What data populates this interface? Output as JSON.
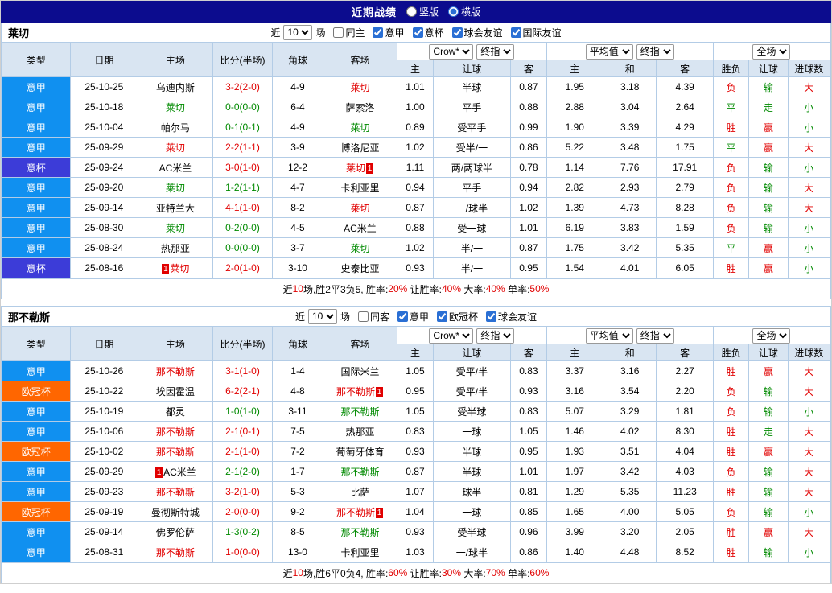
{
  "topbar": {
    "title": "近期战绩",
    "vertical": {
      "label": "竖版",
      "selected": false
    },
    "horizontal": {
      "label": "横版",
      "selected": true
    }
  },
  "colors": {
    "red": "#e10000",
    "green": "#008a00",
    "black": "#000000"
  },
  "league_colors": {
    "意甲": "#1090f0",
    "意杯": "#3c3cd8",
    "欧冠杯": "#ff6600"
  },
  "table": {
    "main_headers": [
      "类型",
      "日期",
      "主场",
      "比分(半场)",
      "角球",
      "客场"
    ],
    "sub_headers": [
      "主",
      "让球",
      "客",
      "主",
      "和",
      "客",
      "胜负",
      "让球",
      "进球数"
    ],
    "selects": {
      "odds_source": "Crow*",
      "odds_kind": "终指",
      "euro_source": "平均值",
      "euro_kind": "终指",
      "scope": "全场"
    }
  },
  "sections": [
    {
      "team": "莱切",
      "filter": {
        "near": "近",
        "count": "10",
        "unit": "场",
        "checkboxes": [
          {
            "label": "同主",
            "checked": false
          },
          {
            "label": "意甲",
            "checked": true
          },
          {
            "label": "意杯",
            "checked": true
          },
          {
            "label": "球会友谊",
            "checked": true
          },
          {
            "label": "国际友谊",
            "checked": true
          }
        ]
      },
      "rows": [
        {
          "type": "意甲",
          "date": "25-10-25",
          "home": "乌迪内斯",
          "home_color": "black",
          "score": "3-2(2-0)",
          "score_color": "red",
          "corners": "4-9",
          "away": "莱切",
          "away_color": "red",
          "ah_h": "1.01",
          "ah_l": "半球",
          "ah_a": "0.87",
          "eu_h": "1.95",
          "eu_d": "3.18",
          "eu_a": "4.39",
          "res": "负",
          "res_c": "red",
          "cov": "输",
          "cov_c": "green",
          "ou": "大",
          "ou_c": "red"
        },
        {
          "type": "意甲",
          "date": "25-10-18",
          "home": "莱切",
          "home_color": "green",
          "score": "0-0(0-0)",
          "score_color": "green",
          "corners": "6-4",
          "away": "萨索洛",
          "away_color": "black",
          "ah_h": "1.00",
          "ah_l": "平手",
          "ah_a": "0.88",
          "eu_h": "2.88",
          "eu_d": "3.04",
          "eu_a": "2.64",
          "res": "平",
          "res_c": "green",
          "cov": "走",
          "cov_c": "green",
          "ou": "小",
          "ou_c": "green"
        },
        {
          "type": "意甲",
          "date": "25-10-04",
          "home": "帕尔马",
          "home_color": "black",
          "score": "0-1(0-1)",
          "score_color": "green",
          "corners": "4-9",
          "away": "莱切",
          "away_color": "green",
          "ah_h": "0.89",
          "ah_l": "受平手",
          "ah_a": "0.99",
          "eu_h": "1.90",
          "eu_d": "3.39",
          "eu_a": "4.29",
          "res": "胜",
          "res_c": "red",
          "cov": "赢",
          "cov_c": "red",
          "ou": "小",
          "ou_c": "green"
        },
        {
          "type": "意甲",
          "date": "25-09-29",
          "home": "莱切",
          "home_color": "red",
          "score": "2-2(1-1)",
          "score_color": "red",
          "corners": "3-9",
          "away": "博洛尼亚",
          "away_color": "black",
          "ah_h": "1.02",
          "ah_l": "受半/一",
          "ah_a": "0.86",
          "eu_h": "5.22",
          "eu_d": "3.48",
          "eu_a": "1.75",
          "res": "平",
          "res_c": "green",
          "cov": "赢",
          "cov_c": "red",
          "ou": "大",
          "ou_c": "red"
        },
        {
          "type": "意杯",
          "date": "25-09-24",
          "home": "AC米兰",
          "home_color": "black",
          "score": "3-0(1-0)",
          "score_color": "red",
          "corners": "12-2",
          "away": "莱切",
          "away_color": "red",
          "away_badge": "1",
          "away_badge_pos": "after",
          "ah_h": "1.11",
          "ah_l": "两/两球半",
          "ah_a": "0.78",
          "eu_h": "1.14",
          "eu_d": "7.76",
          "eu_a": "17.91",
          "res": "负",
          "res_c": "red",
          "cov": "输",
          "cov_c": "green",
          "ou": "小",
          "ou_c": "green"
        },
        {
          "type": "意甲",
          "date": "25-09-20",
          "home": "莱切",
          "home_color": "green",
          "score": "1-2(1-1)",
          "score_color": "green",
          "corners": "4-7",
          "away": "卡利亚里",
          "away_color": "black",
          "ah_h": "0.94",
          "ah_l": "平手",
          "ah_a": "0.94",
          "eu_h": "2.82",
          "eu_d": "2.93",
          "eu_a": "2.79",
          "res": "负",
          "res_c": "red",
          "cov": "输",
          "cov_c": "green",
          "ou": "大",
          "ou_c": "red"
        },
        {
          "type": "意甲",
          "date": "25-09-14",
          "home": "亚特兰大",
          "home_color": "black",
          "score": "4-1(1-0)",
          "score_color": "red",
          "corners": "8-2",
          "away": "莱切",
          "away_color": "red",
          "ah_h": "0.87",
          "ah_l": "一/球半",
          "ah_a": "1.02",
          "eu_h": "1.39",
          "eu_d": "4.73",
          "eu_a": "8.28",
          "res": "负",
          "res_c": "red",
          "cov": "输",
          "cov_c": "green",
          "ou": "大",
          "ou_c": "red"
        },
        {
          "type": "意甲",
          "date": "25-08-30",
          "home": "莱切",
          "home_color": "green",
          "score": "0-2(0-0)",
          "score_color": "green",
          "corners": "4-5",
          "away": "AC米兰",
          "away_color": "black",
          "ah_h": "0.88",
          "ah_l": "受一球",
          "ah_a": "1.01",
          "eu_h": "6.19",
          "eu_d": "3.83",
          "eu_a": "1.59",
          "res": "负",
          "res_c": "red",
          "cov": "输",
          "cov_c": "green",
          "ou": "小",
          "ou_c": "green"
        },
        {
          "type": "意甲",
          "date": "25-08-24",
          "home": "热那亚",
          "home_color": "black",
          "score": "0-0(0-0)",
          "score_color": "green",
          "corners": "3-7",
          "away": "莱切",
          "away_color": "green",
          "ah_h": "1.02",
          "ah_l": "半/一",
          "ah_a": "0.87",
          "eu_h": "1.75",
          "eu_d": "3.42",
          "eu_a": "5.35",
          "res": "平",
          "res_c": "green",
          "cov": "赢",
          "cov_c": "red",
          "ou": "小",
          "ou_c": "green"
        },
        {
          "type": "意杯",
          "date": "25-08-16",
          "home": "莱切",
          "home_color": "red",
          "home_badge": "1",
          "home_badge_pos": "before",
          "score": "2-0(1-0)",
          "score_color": "red",
          "corners": "3-10",
          "away": "史泰比亚",
          "away_color": "black",
          "ah_h": "0.93",
          "ah_l": "半/一",
          "ah_a": "0.95",
          "eu_h": "1.54",
          "eu_d": "4.01",
          "eu_a": "6.05",
          "res": "胜",
          "res_c": "red",
          "cov": "赢",
          "cov_c": "red",
          "ou": "小",
          "ou_c": "green"
        }
      ],
      "footer": [
        {
          "text": "近",
          "color": "black"
        },
        {
          "text": "10",
          "color": "red"
        },
        {
          "text": "场,胜2平3负5, 胜率:",
          "color": "black"
        },
        {
          "text": "20%",
          "color": "red"
        },
        {
          "text": " 让胜率:",
          "color": "black"
        },
        {
          "text": "40%",
          "color": "red"
        },
        {
          "text": " 大率:",
          "color": "black"
        },
        {
          "text": "40%",
          "color": "red"
        },
        {
          "text": " 单率:",
          "color": "black"
        },
        {
          "text": "50%",
          "color": "red"
        }
      ]
    },
    {
      "team": "那不勒斯",
      "filter": {
        "near": "近",
        "count": "10",
        "unit": "场",
        "checkboxes": [
          {
            "label": "同客",
            "checked": false
          },
          {
            "label": "意甲",
            "checked": true
          },
          {
            "label": "欧冠杯",
            "checked": true
          },
          {
            "label": "球会友谊",
            "checked": true
          }
        ]
      },
      "rows": [
        {
          "type": "意甲",
          "date": "25-10-26",
          "home": "那不勒斯",
          "home_color": "red",
          "score": "3-1(1-0)",
          "score_color": "red",
          "corners": "1-4",
          "away": "国际米兰",
          "away_color": "black",
          "ah_h": "1.05",
          "ah_l": "受平/半",
          "ah_a": "0.83",
          "eu_h": "3.37",
          "eu_d": "3.16",
          "eu_a": "2.27",
          "res": "胜",
          "res_c": "red",
          "cov": "赢",
          "cov_c": "red",
          "ou": "大",
          "ou_c": "red"
        },
        {
          "type": "欧冠杯",
          "date": "25-10-22",
          "home": "埃因霍温",
          "home_color": "black",
          "score": "6-2(2-1)",
          "score_color": "red",
          "corners": "4-8",
          "away": "那不勒斯",
          "away_color": "red",
          "away_badge": "1",
          "away_badge_pos": "after",
          "ah_h": "0.95",
          "ah_l": "受平/半",
          "ah_a": "0.93",
          "eu_h": "3.16",
          "eu_d": "3.54",
          "eu_a": "2.20",
          "res": "负",
          "res_c": "red",
          "cov": "输",
          "cov_c": "green",
          "ou": "大",
          "ou_c": "red"
        },
        {
          "type": "意甲",
          "date": "25-10-19",
          "home": "都灵",
          "home_color": "black",
          "score": "1-0(1-0)",
          "score_color": "green",
          "corners": "3-11",
          "away": "那不勒斯",
          "away_color": "green",
          "ah_h": "1.05",
          "ah_l": "受半球",
          "ah_a": "0.83",
          "eu_h": "5.07",
          "eu_d": "3.29",
          "eu_a": "1.81",
          "res": "负",
          "res_c": "red",
          "cov": "输",
          "cov_c": "green",
          "ou": "小",
          "ou_c": "green"
        },
        {
          "type": "意甲",
          "date": "25-10-06",
          "home": "那不勒斯",
          "home_color": "red",
          "score": "2-1(0-1)",
          "score_color": "red",
          "corners": "7-5",
          "away": "热那亚",
          "away_color": "black",
          "ah_h": "0.83",
          "ah_l": "一球",
          "ah_a": "1.05",
          "eu_h": "1.46",
          "eu_d": "4.02",
          "eu_a": "8.30",
          "res": "胜",
          "res_c": "red",
          "cov": "走",
          "cov_c": "green",
          "ou": "大",
          "ou_c": "red"
        },
        {
          "type": "欧冠杯",
          "date": "25-10-02",
          "home": "那不勒斯",
          "home_color": "red",
          "score": "2-1(1-0)",
          "score_color": "red",
          "corners": "7-2",
          "away": "葡萄牙体育",
          "away_color": "black",
          "ah_h": "0.93",
          "ah_l": "半球",
          "ah_a": "0.95",
          "eu_h": "1.93",
          "eu_d": "3.51",
          "eu_a": "4.04",
          "res": "胜",
          "res_c": "red",
          "cov": "赢",
          "cov_c": "red",
          "ou": "大",
          "ou_c": "red"
        },
        {
          "type": "意甲",
          "date": "25-09-29",
          "home": "AC米兰",
          "home_color": "black",
          "home_badge": "1",
          "home_badge_pos": "before",
          "score": "2-1(2-0)",
          "score_color": "green",
          "corners": "1-7",
          "away": "那不勒斯",
          "away_color": "green",
          "ah_h": "0.87",
          "ah_l": "半球",
          "ah_a": "1.01",
          "eu_h": "1.97",
          "eu_d": "3.42",
          "eu_a": "4.03",
          "res": "负",
          "res_c": "red",
          "cov": "输",
          "cov_c": "green",
          "ou": "大",
          "ou_c": "red"
        },
        {
          "type": "意甲",
          "date": "25-09-23",
          "home": "那不勒斯",
          "home_color": "red",
          "score": "3-2(1-0)",
          "score_color": "red",
          "corners": "5-3",
          "away": "比萨",
          "away_color": "black",
          "ah_h": "1.07",
          "ah_l": "球半",
          "ah_a": "0.81",
          "eu_h": "1.29",
          "eu_d": "5.35",
          "eu_a": "11.23",
          "res": "胜",
          "res_c": "red",
          "cov": "输",
          "cov_c": "green",
          "ou": "大",
          "ou_c": "red"
        },
        {
          "type": "欧冠杯",
          "date": "25-09-19",
          "home": "曼彻斯特城",
          "home_color": "black",
          "score": "2-0(0-0)",
          "score_color": "red",
          "corners": "9-2",
          "away": "那不勒斯",
          "away_color": "red",
          "away_badge": "1",
          "away_badge_pos": "after",
          "ah_h": "1.04",
          "ah_l": "一球",
          "ah_a": "0.85",
          "eu_h": "1.65",
          "eu_d": "4.00",
          "eu_a": "5.05",
          "res": "负",
          "res_c": "red",
          "cov": "输",
          "cov_c": "green",
          "ou": "小",
          "ou_c": "green"
        },
        {
          "type": "意甲",
          "date": "25-09-14",
          "home": "佛罗伦萨",
          "home_color": "black",
          "score": "1-3(0-2)",
          "score_color": "green",
          "corners": "8-5",
          "away": "那不勒斯",
          "away_color": "green",
          "ah_h": "0.93",
          "ah_l": "受半球",
          "ah_a": "0.96",
          "eu_h": "3.99",
          "eu_d": "3.20",
          "eu_a": "2.05",
          "res": "胜",
          "res_c": "red",
          "cov": "赢",
          "cov_c": "red",
          "ou": "大",
          "ou_c": "red"
        },
        {
          "type": "意甲",
          "date": "25-08-31",
          "home": "那不勒斯",
          "home_color": "red",
          "score": "1-0(0-0)",
          "score_color": "red",
          "corners": "13-0",
          "away": "卡利亚里",
          "away_color": "black",
          "ah_h": "1.03",
          "ah_l": "一/球半",
          "ah_a": "0.86",
          "eu_h": "1.40",
          "eu_d": "4.48",
          "eu_a": "8.52",
          "res": "胜",
          "res_c": "red",
          "cov": "输",
          "cov_c": "green",
          "ou": "小",
          "ou_c": "green"
        }
      ],
      "footer": [
        {
          "text": "近",
          "color": "black"
        },
        {
          "text": "10",
          "color": "red"
        },
        {
          "text": "场,胜6平0负4, 胜率:",
          "color": "black"
        },
        {
          "text": "60%",
          "color": "red"
        },
        {
          "text": " 让胜率:",
          "color": "black"
        },
        {
          "text": "30%",
          "color": "red"
        },
        {
          "text": " 大率:",
          "color": "black"
        },
        {
          "text": "70%",
          "color": "red"
        },
        {
          "text": " 单率:",
          "color": "black"
        },
        {
          "text": "60%",
          "color": "red"
        }
      ]
    }
  ]
}
